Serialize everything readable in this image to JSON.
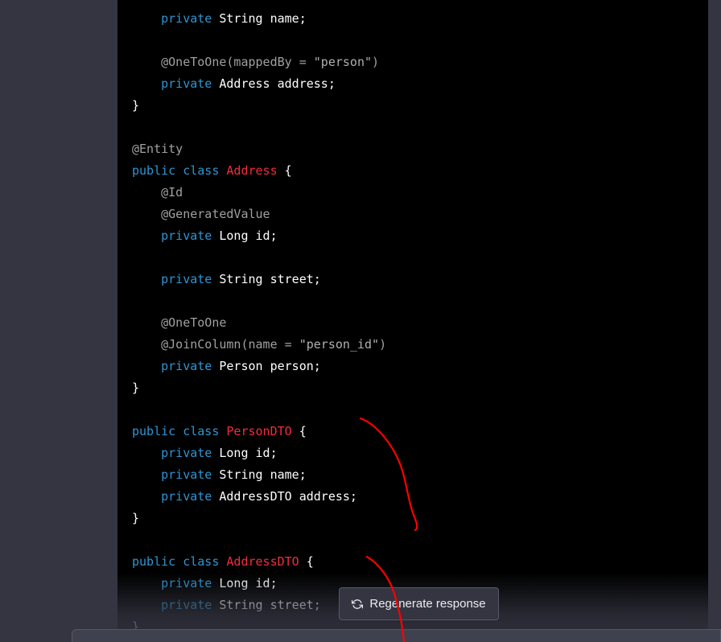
{
  "code_lines": [
    [
      {
        "t": "    "
      },
      {
        "t": "private",
        "c": "kw"
      },
      {
        "t": " String name;"
      }
    ],
    [],
    [
      {
        "t": "    "
      },
      {
        "t": "@OneToOne",
        "c": "ann"
      },
      {
        "t": "(mappedBy = ",
        "c": "ann"
      },
      {
        "t": "\"person\"",
        "c": "str"
      },
      {
        "t": ")",
        "c": "ann"
      }
    ],
    [
      {
        "t": "    "
      },
      {
        "t": "private",
        "c": "kw"
      },
      {
        "t": " Address address;"
      }
    ],
    [
      {
        "t": "}"
      }
    ],
    [],
    [
      {
        "t": "@Entity",
        "c": "ann"
      }
    ],
    [
      {
        "t": "public",
        "c": "kw"
      },
      {
        "t": " "
      },
      {
        "t": "class",
        "c": "kw"
      },
      {
        "t": " "
      },
      {
        "t": "Address",
        "c": "cls"
      },
      {
        "t": " {"
      }
    ],
    [
      {
        "t": "    "
      },
      {
        "t": "@Id",
        "c": "ann"
      }
    ],
    [
      {
        "t": "    "
      },
      {
        "t": "@GeneratedValue",
        "c": "ann"
      }
    ],
    [
      {
        "t": "    "
      },
      {
        "t": "private",
        "c": "kw"
      },
      {
        "t": " Long id;"
      }
    ],
    [],
    [
      {
        "t": "    "
      },
      {
        "t": "private",
        "c": "kw"
      },
      {
        "t": " String street;"
      }
    ],
    [],
    [
      {
        "t": "    "
      },
      {
        "t": "@OneToOne",
        "c": "ann"
      }
    ],
    [
      {
        "t": "    "
      },
      {
        "t": "@JoinColumn",
        "c": "ann"
      },
      {
        "t": "(name = ",
        "c": "ann"
      },
      {
        "t": "\"person_id\"",
        "c": "str"
      },
      {
        "t": ")",
        "c": "ann"
      }
    ],
    [
      {
        "t": "    "
      },
      {
        "t": "private",
        "c": "kw"
      },
      {
        "t": " Person person;"
      }
    ],
    [
      {
        "t": "}"
      }
    ],
    [],
    [
      {
        "t": "public",
        "c": "kw"
      },
      {
        "t": " "
      },
      {
        "t": "class",
        "c": "kw"
      },
      {
        "t": " "
      },
      {
        "t": "PersonDTO",
        "c": "cls"
      },
      {
        "t": " {"
      }
    ],
    [
      {
        "t": "    "
      },
      {
        "t": "private",
        "c": "kw"
      },
      {
        "t": " Long id;"
      }
    ],
    [
      {
        "t": "    "
      },
      {
        "t": "private",
        "c": "kw"
      },
      {
        "t": " String name;"
      }
    ],
    [
      {
        "t": "    "
      },
      {
        "t": "private",
        "c": "kw"
      },
      {
        "t": " AddressDTO address;"
      }
    ],
    [
      {
        "t": "}"
      }
    ],
    [],
    [
      {
        "t": "public",
        "c": "kw"
      },
      {
        "t": " "
      },
      {
        "t": "class",
        "c": "kw"
      },
      {
        "t": " "
      },
      {
        "t": "AddressDTO",
        "c": "cls"
      },
      {
        "t": " {"
      }
    ],
    [
      {
        "t": "    "
      },
      {
        "t": "private",
        "c": "kw"
      },
      {
        "t": " Long id;"
      }
    ],
    [
      {
        "t": "    "
      },
      {
        "t": "private",
        "c": "kw"
      },
      {
        "t": " String street;"
      }
    ],
    [
      {
        "t": "}"
      }
    ]
  ],
  "regenerate": {
    "label": "Regenerate response",
    "icon": "refresh-icon"
  },
  "colors": {
    "keyword": "#2e95d3",
    "class_name": "#f22c3d",
    "annotation": "#a0a0a0",
    "code_background": "#000000",
    "page_background": "#343541",
    "annotation_stroke": "#ff0000"
  }
}
